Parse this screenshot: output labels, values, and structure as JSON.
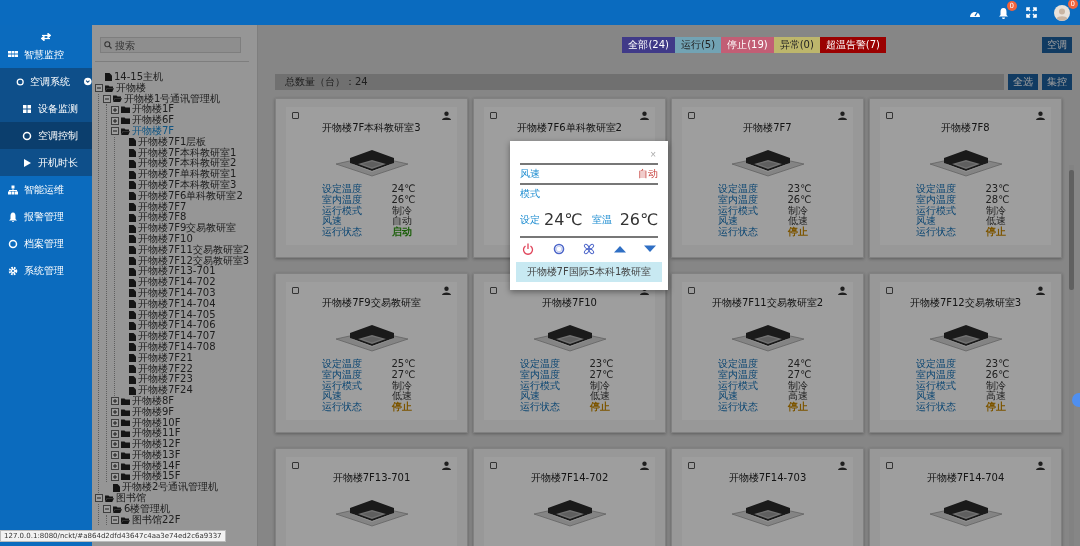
{
  "header": {
    "notification_badge": "0",
    "avatar_badge": "0"
  },
  "sidebar": {
    "items": [
      {
        "label": "智慧监控",
        "selected": false,
        "children": [
          {
            "label": "空调系统",
            "selected": false,
            "expanded": true,
            "children": [
              {
                "label": "设备监测",
                "selected": false
              },
              {
                "label": "空调控制",
                "selected": true
              },
              {
                "label": "开机时长",
                "selected": false
              }
            ]
          }
        ]
      },
      {
        "label": "智能运维",
        "selected": false
      },
      {
        "label": "报警管理",
        "selected": false
      },
      {
        "label": "档案管理",
        "selected": false
      },
      {
        "label": "系统管理",
        "selected": false
      }
    ]
  },
  "tree": {
    "search_placeholder": "搜索",
    "items": [
      {
        "label": "14-15主机",
        "kind": "file",
        "selected": false
      },
      {
        "label": "开物楼",
        "kind": "folder",
        "expanded": true,
        "selected": false,
        "children": [
          {
            "label": "开物楼1号通讯管理机",
            "kind": "folder",
            "expanded": true,
            "selected": false,
            "children": [
              {
                "label": "开物楼1F",
                "kind": "folder",
                "expanded": false,
                "selected": false
              },
              {
                "label": "开物楼6F",
                "kind": "folder",
                "expanded": false,
                "selected": false
              },
              {
                "label": "开物楼7F",
                "kind": "folder",
                "expanded": true,
                "selected": true,
                "children": [
                  {
                    "label": "开物楼7F1层板",
                    "kind": "file",
                    "selected": false
                  },
                  {
                    "label": "开物楼7F本科教研室1",
                    "kind": "file",
                    "selected": false
                  },
                  {
                    "label": "开物楼7F本科教研室2",
                    "kind": "file",
                    "selected": false
                  },
                  {
                    "label": "开物楼7F单科教研室1",
                    "kind": "file",
                    "selected": false
                  },
                  {
                    "label": "开物楼7F本科教研室3",
                    "kind": "file",
                    "selected": false
                  },
                  {
                    "label": "开物楼7F6单科教研室2",
                    "kind": "file",
                    "selected": false
                  },
                  {
                    "label": "开物楼7F7",
                    "kind": "file",
                    "selected": false
                  },
                  {
                    "label": "开物楼7F8",
                    "kind": "file",
                    "selected": false
                  },
                  {
                    "label": "开物楼7F9交易教研室",
                    "kind": "file",
                    "selected": false
                  },
                  {
                    "label": "开物楼7F10",
                    "kind": "file",
                    "selected": false
                  },
                  {
                    "label": "开物楼7F11交易教研室2",
                    "kind": "file",
                    "selected": false
                  },
                  {
                    "label": "开物楼7F12交易教研室3",
                    "kind": "file",
                    "selected": false
                  },
                  {
                    "label": "开物楼7F13-701",
                    "kind": "file",
                    "selected": false
                  },
                  {
                    "label": "开物楼7F14-702",
                    "kind": "file",
                    "selected": false
                  },
                  {
                    "label": "开物楼7F14-703",
                    "kind": "file",
                    "selected": false
                  },
                  {
                    "label": "开物楼7F14-704",
                    "kind": "file",
                    "selected": false
                  },
                  {
                    "label": "开物楼7F14-705",
                    "kind": "file",
                    "selected": false
                  },
                  {
                    "label": "开物楼7F14-706",
                    "kind": "file",
                    "selected": false
                  },
                  {
                    "label": "开物楼7F14-707",
                    "kind": "file",
                    "selected": false
                  },
                  {
                    "label": "开物楼7F14-708",
                    "kind": "file",
                    "selected": false
                  },
                  {
                    "label": "开物楼7F21",
                    "kind": "file",
                    "selected": false
                  },
                  {
                    "label": "开物楼7F22",
                    "kind": "file",
                    "selected": false
                  },
                  {
                    "label": "开物楼7F23",
                    "kind": "file",
                    "selected": false
                  },
                  {
                    "label": "开物楼7F24",
                    "kind": "file",
                    "selected": false
                  }
                ]
              },
              {
                "label": "开物楼8F",
                "kind": "folder",
                "expanded": false,
                "selected": false
              },
              {
                "label": "开物楼9F",
                "kind": "folder",
                "expanded": false,
                "selected": false
              },
              {
                "label": "开物楼10F",
                "kind": "folder",
                "expanded": false,
                "selected": false
              },
              {
                "label": "开物楼11F",
                "kind": "folder",
                "expanded": false,
                "selected": false
              },
              {
                "label": "开物楼12F",
                "kind": "folder",
                "expanded": false,
                "selected": false
              },
              {
                "label": "开物楼13F",
                "kind": "folder",
                "expanded": false,
                "selected": false
              },
              {
                "label": "开物楼14F",
                "kind": "folder",
                "expanded": false,
                "selected": false
              },
              {
                "label": "开物楼15F",
                "kind": "folder",
                "expanded": false,
                "selected": false
              }
            ]
          },
          {
            "label": "开物楼2号通讯管理机",
            "kind": "file",
            "selected": false
          }
        ]
      },
      {
        "label": "图书馆",
        "kind": "folder",
        "expanded": true,
        "selected": false,
        "children": [
          {
            "label": "6楼管理机",
            "kind": "folder",
            "expanded": true,
            "selected": false,
            "children": [
              {
                "label": "图书馆22F",
                "kind": "folder",
                "expanded": true,
                "selected": false
              }
            ]
          }
        ]
      }
    ]
  },
  "filters": [
    {
      "label": "全部(24)",
      "color": "#403a88"
    },
    {
      "label": "运行(5)",
      "color": "#72a3b4"
    },
    {
      "label": "停止(19)",
      "color": "#c25e75"
    },
    {
      "label": "异常(0)",
      "color": "#bdb66c"
    },
    {
      "label": "超温告警(7)",
      "color": "#9a0000"
    }
  ],
  "ac_button": "空调",
  "total": "总数量（台）：24",
  "actions": [
    "全选",
    "集控"
  ],
  "cards": [
    {
      "title": "开物楼7F本科教研室3",
      "checked": false,
      "fields": [
        {
          "label": "设定温度",
          "value": "24℃"
        },
        {
          "label": "室内温度",
          "value": "26℃"
        },
        {
          "label": "运行模式",
          "value": "制冷"
        },
        {
          "label": "风速",
          "value": "自动"
        },
        {
          "label": "运行状态",
          "value": "启动",
          "running": true
        }
      ]
    },
    {
      "title": "开物楼7F6单科教研室2",
      "checked": false
    },
    {
      "title": "开物楼7F7",
      "checked": false,
      "fields": [
        {
          "label": "设定温度",
          "value": "23℃"
        },
        {
          "label": "室内温度",
          "value": "26℃"
        },
        {
          "label": "运行模式",
          "value": "制冷"
        },
        {
          "label": "风速",
          "value": "低速"
        },
        {
          "label": "运行状态",
          "value": "停止",
          "running": false
        }
      ]
    },
    {
      "title": "开物楼7F8",
      "checked": false,
      "fields": [
        {
          "label": "设定温度",
          "value": "23℃"
        },
        {
          "label": "室内温度",
          "value": "28℃"
        },
        {
          "label": "运行模式",
          "value": "制冷"
        },
        {
          "label": "风速",
          "value": "低速"
        },
        {
          "label": "运行状态",
          "value": "停止",
          "running": false
        }
      ]
    },
    {
      "title": "开物楼7F9交易教研室",
      "checked": false,
      "fields": [
        {
          "label": "设定温度",
          "value": "25℃"
        },
        {
          "label": "室内温度",
          "value": "27℃"
        },
        {
          "label": "运行模式",
          "value": "制冷"
        },
        {
          "label": "风速",
          "value": "低速"
        },
        {
          "label": "运行状态",
          "value": "停止",
          "running": false
        }
      ]
    },
    {
      "title": "开物楼7F10",
      "checked": false,
      "fields": [
        {
          "label": "设定温度",
          "value": "23℃"
        },
        {
          "label": "室内温度",
          "value": "27℃"
        },
        {
          "label": "运行模式",
          "value": "制冷"
        },
        {
          "label": "风速",
          "value": "低速"
        },
        {
          "label": "运行状态",
          "value": "停止",
          "running": false
        }
      ]
    },
    {
      "title": "开物楼7F11交易教研室2",
      "checked": false,
      "fields": [
        {
          "label": "设定温度",
          "value": "24℃"
        },
        {
          "label": "室内温度",
          "value": "27℃"
        },
        {
          "label": "运行模式",
          "value": "制冷"
        },
        {
          "label": "风速",
          "value": "高速"
        },
        {
          "label": "运行状态",
          "value": "停止",
          "running": false
        }
      ]
    },
    {
      "title": "开物楼7F12交易教研室3",
      "checked": false,
      "fields": [
        {
          "label": "设定温度",
          "value": "23℃"
        },
        {
          "label": "室内温度",
          "value": "26℃"
        },
        {
          "label": "运行模式",
          "value": "制冷"
        },
        {
          "label": "风速",
          "value": "高速"
        },
        {
          "label": "运行状态",
          "value": "停止",
          "running": false
        }
      ]
    },
    {
      "title": "开物楼7F13-701",
      "checked": false
    },
    {
      "title": "开物楼7F14-702",
      "checked": false
    },
    {
      "title": "开物楼7F14-703",
      "checked": false
    },
    {
      "title": "开物楼7F14-704",
      "checked": false
    }
  ],
  "modal": {
    "close": "×",
    "rows": [
      {
        "label": "风速",
        "value": "自动"
      },
      {
        "label": "模式"
      }
    ],
    "set_label": "设定",
    "set_temp": "24℃",
    "room_label": "室温",
    "room_temp": "26℃",
    "room_name": "开物楼7F国际5本科1教研室"
  },
  "status_url": "127.0.0.1:8080/nckt/#a864d2dfd43647c4aa3e74ed2c6a9337"
}
